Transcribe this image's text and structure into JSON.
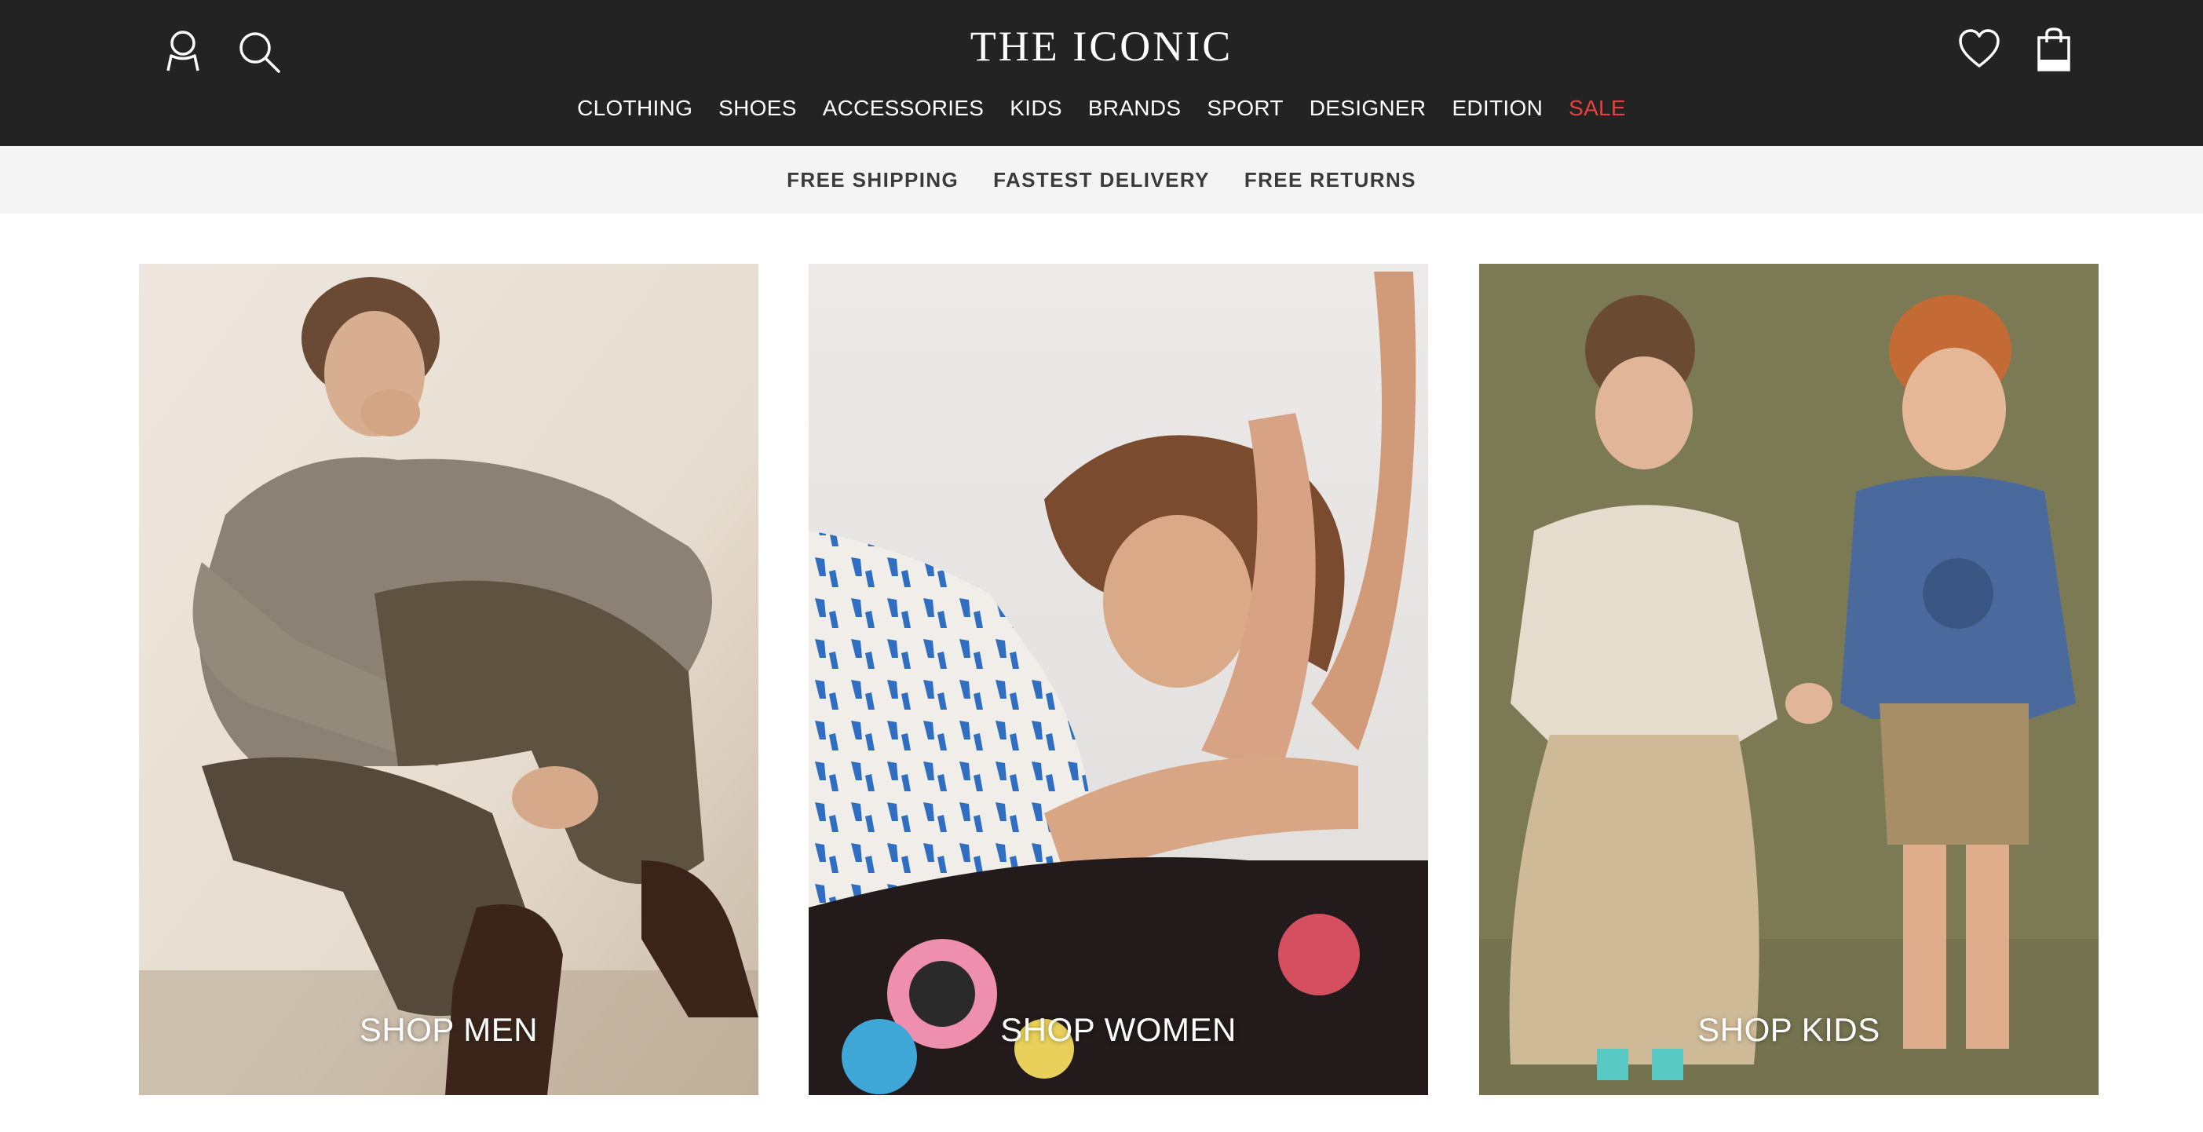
{
  "header": {
    "logo": "THE ICONIC",
    "icons": [
      "account-icon",
      "search-icon",
      "wishlist-icon",
      "bag-icon"
    ]
  },
  "nav": {
    "items": [
      "CLOTHING",
      "SHOES",
      "ACCESSORIES",
      "KIDS",
      "BRANDS",
      "SPORT",
      "DESIGNER",
      "EDITION"
    ],
    "sale": "SALE"
  },
  "promo": {
    "items": [
      "FREE SHIPPING",
      "FASTEST DELIVERY",
      "FREE RETURNS"
    ]
  },
  "tiles": [
    {
      "label": "SHOP MEN"
    },
    {
      "label": "SHOP WOMEN"
    },
    {
      "label": "SHOP KIDS"
    }
  ],
  "colors": {
    "header_bg": "#232323",
    "promo_bg": "#f4f4f4",
    "sale_accent": "#e64040",
    "kids_backdrop": "#7c7a55"
  }
}
